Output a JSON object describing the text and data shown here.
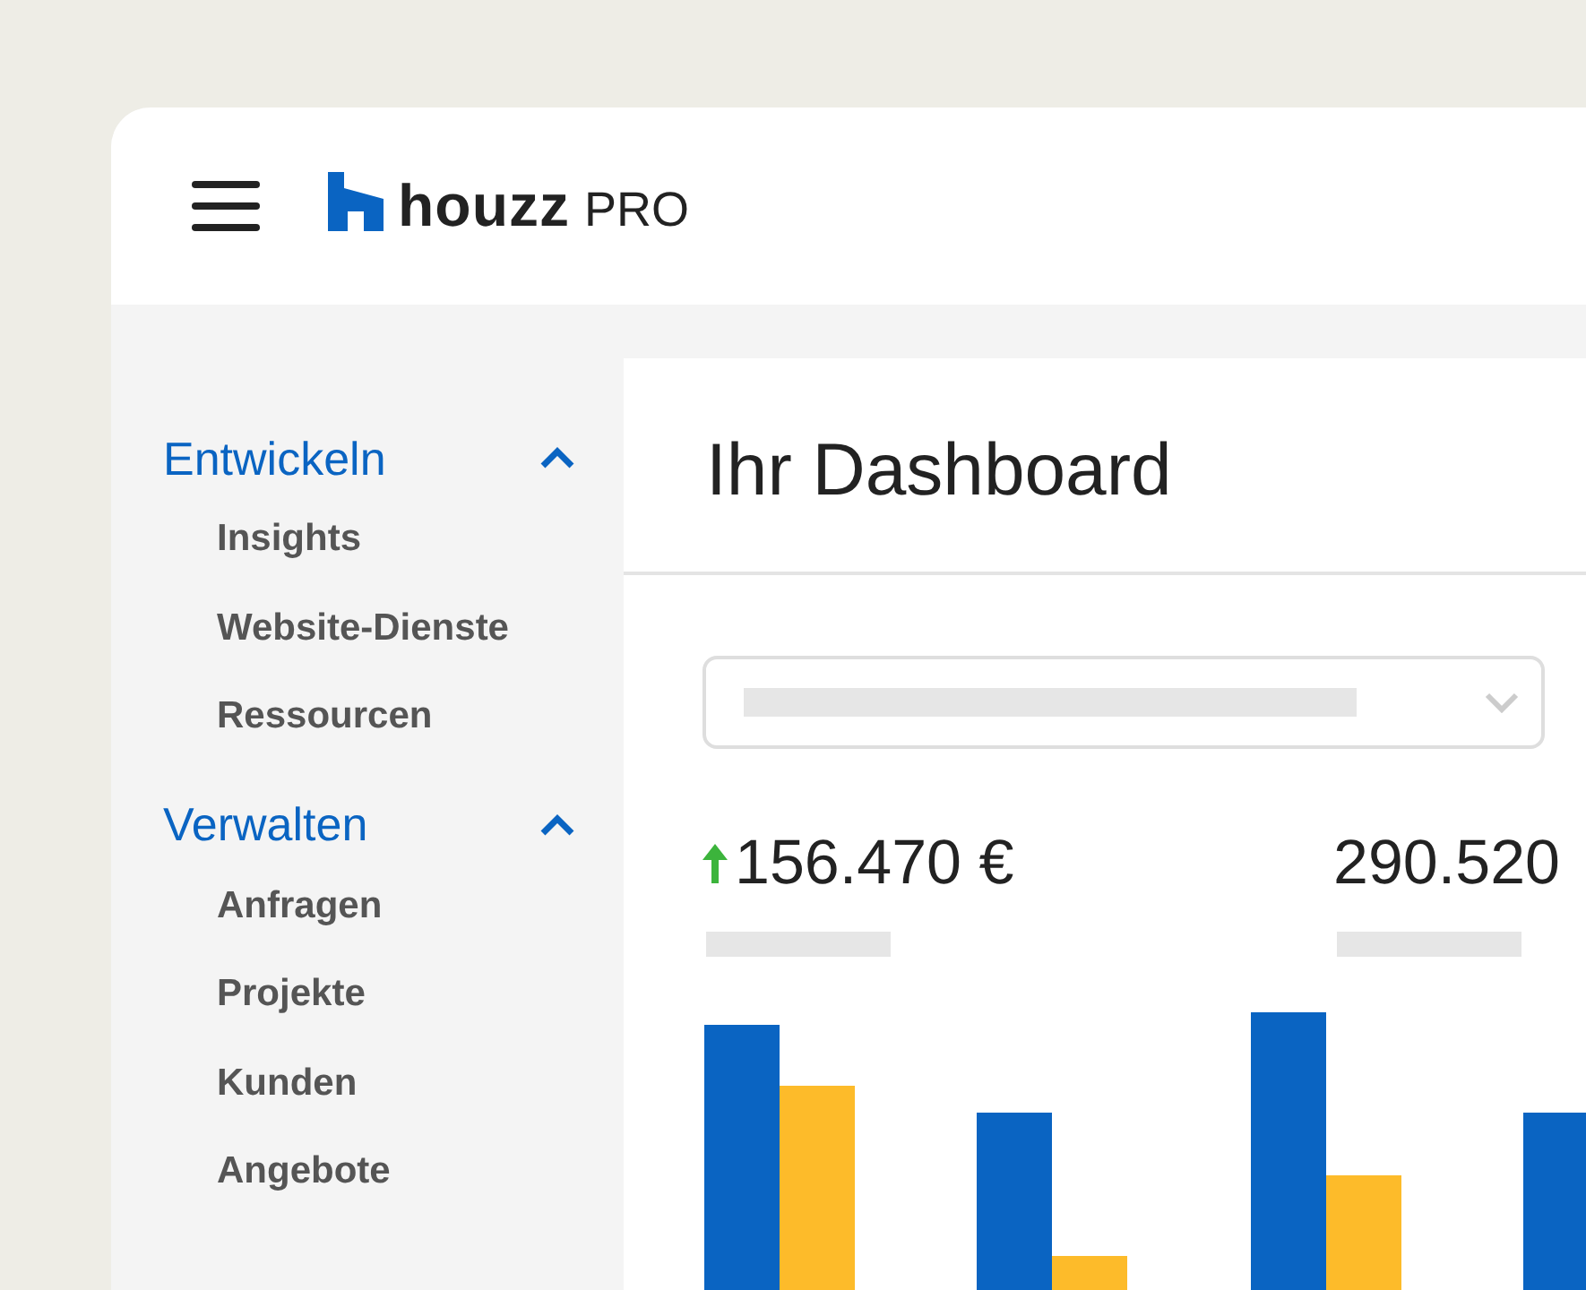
{
  "header": {
    "logo": {
      "wordmark": "houzz",
      "suffix": "PRO"
    }
  },
  "sidebar": {
    "sections": [
      {
        "title": "Entwickeln",
        "expanded": true,
        "items": [
          "Insights",
          "Website-Dienste",
          "Ressourcen"
        ]
      },
      {
        "title": "Verwalten",
        "expanded": true,
        "items": [
          "Anfragen",
          "Projekte",
          "Kunden",
          "Angebote"
        ]
      }
    ]
  },
  "main": {
    "title": "Ihr Dashboard",
    "stats": [
      {
        "value": "156.470 €",
        "rising": true
      },
      {
        "value": "290.520",
        "rising": false
      }
    ]
  }
}
